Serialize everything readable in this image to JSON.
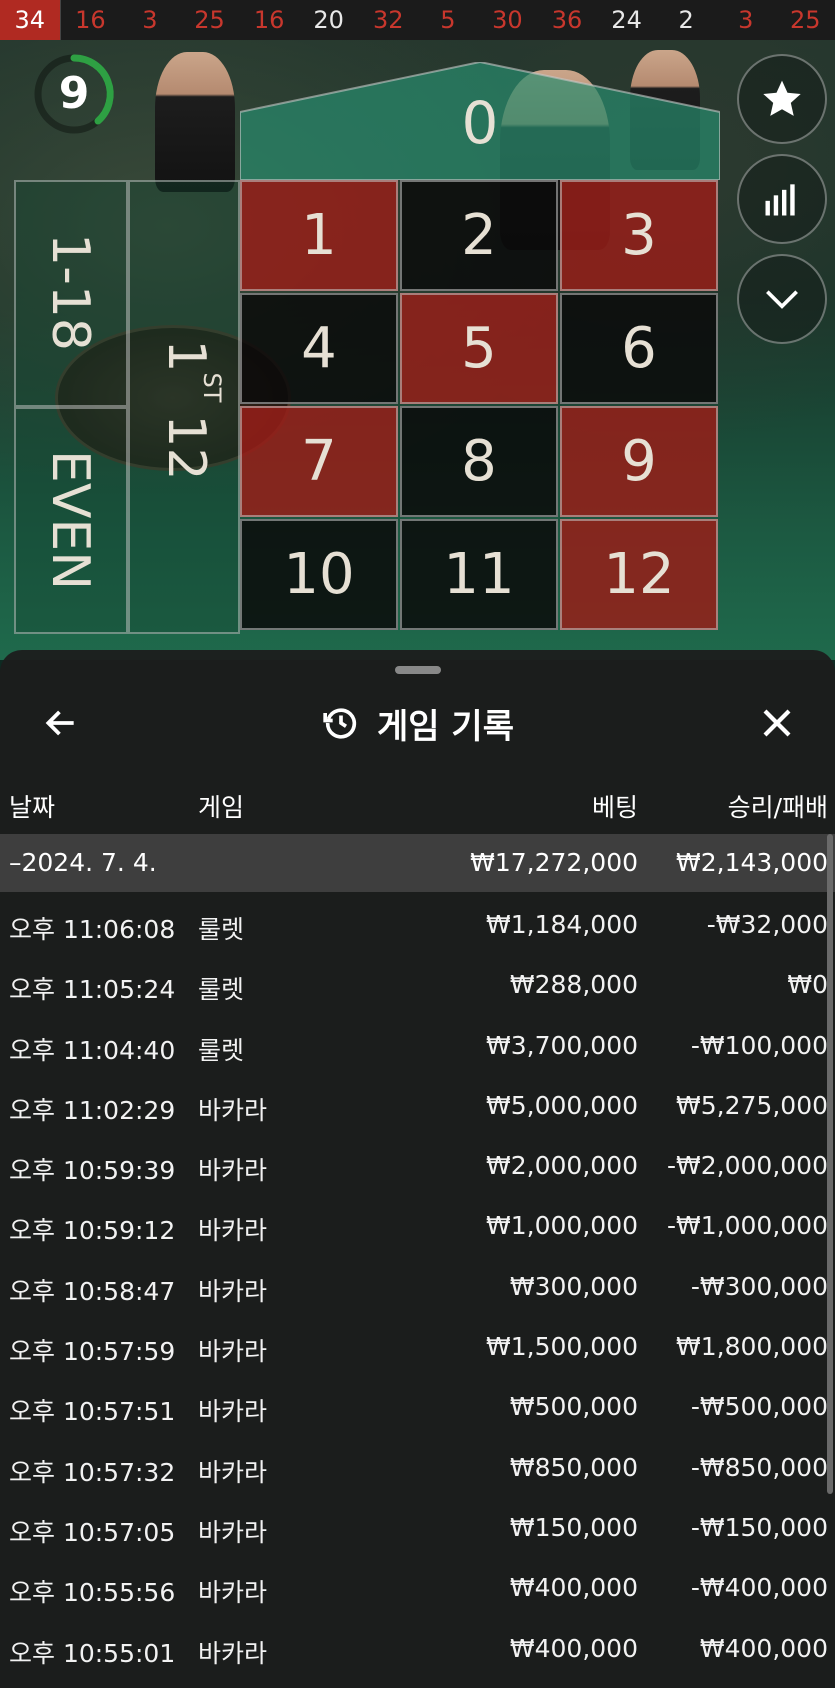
{
  "results_strip": [
    {
      "value": "34",
      "color": "red",
      "latest": true
    },
    {
      "value": "16",
      "color": "red"
    },
    {
      "value": "3",
      "color": "red"
    },
    {
      "value": "25",
      "color": "red"
    },
    {
      "value": "16",
      "color": "red"
    },
    {
      "value": "20",
      "color": "white"
    },
    {
      "value": "32",
      "color": "red"
    },
    {
      "value": "5",
      "color": "red"
    },
    {
      "value": "30",
      "color": "red"
    },
    {
      "value": "36",
      "color": "red"
    },
    {
      "value": "24",
      "color": "white"
    },
    {
      "value": "2",
      "color": "white"
    },
    {
      "value": "3",
      "color": "red"
    },
    {
      "value": "25",
      "color": "red"
    }
  ],
  "timer": {
    "value": "9",
    "color": "#2ea043"
  },
  "side_buttons": {
    "favorite_icon": "star-icon",
    "stats_icon": "bar-chart-icon",
    "collapse_icon": "chevron-down-icon"
  },
  "table": {
    "zero": "0",
    "numbers": [
      {
        "n": "1",
        "color": "red"
      },
      {
        "n": "2",
        "color": "black"
      },
      {
        "n": "3",
        "color": "red"
      },
      {
        "n": "4",
        "color": "black"
      },
      {
        "n": "5",
        "color": "red"
      },
      {
        "n": "6",
        "color": "black"
      },
      {
        "n": "7",
        "color": "red"
      },
      {
        "n": "8",
        "color": "black"
      },
      {
        "n": "9",
        "color": "red"
      },
      {
        "n": "10",
        "color": "black"
      },
      {
        "n": "11",
        "color": "black"
      },
      {
        "n": "12",
        "color": "red"
      }
    ],
    "low_label": "1-18",
    "even_label": "EVEN",
    "dozen_label_num": "1",
    "dozen_label_suffix": "ST",
    "dozen_label_12": "12"
  },
  "history": {
    "title": "게임 기록",
    "history_icon": "history-clock-icon",
    "back_icon": "arrow-left-icon",
    "close_icon": "close-icon",
    "columns": {
      "date": "날짜",
      "game": "게임",
      "bet": "베팅",
      "result": "승리/패배"
    },
    "summary": {
      "date": "–2024. 7. 4.",
      "bet": "₩17,272,000",
      "result": "₩2,143,000"
    },
    "rows": [
      {
        "time": "오후 11:06:08",
        "game": "룰렛",
        "bet": "₩1,184,000",
        "result": "-₩32,000"
      },
      {
        "time": "오후 11:05:24",
        "game": "룰렛",
        "bet": "₩288,000",
        "result": "₩0"
      },
      {
        "time": "오후 11:04:40",
        "game": "룰렛",
        "bet": "₩3,700,000",
        "result": "-₩100,000"
      },
      {
        "time": "오후 11:02:29",
        "game": "바카라",
        "bet": "₩5,000,000",
        "result": "₩5,275,000"
      },
      {
        "time": "오후 10:59:39",
        "game": "바카라",
        "bet": "₩2,000,000",
        "result": "-₩2,000,000"
      },
      {
        "time": "오후 10:59:12",
        "game": "바카라",
        "bet": "₩1,000,000",
        "result": "-₩1,000,000"
      },
      {
        "time": "오후 10:58:47",
        "game": "바카라",
        "bet": "₩300,000",
        "result": "-₩300,000"
      },
      {
        "time": "오후 10:57:59",
        "game": "바카라",
        "bet": "₩1,500,000",
        "result": "₩1,800,000"
      },
      {
        "time": "오후 10:57:51",
        "game": "바카라",
        "bet": "₩500,000",
        "result": "-₩500,000"
      },
      {
        "time": "오후 10:57:32",
        "game": "바카라",
        "bet": "₩850,000",
        "result": "-₩850,000"
      },
      {
        "time": "오후 10:57:05",
        "game": "바카라",
        "bet": "₩150,000",
        "result": "-₩150,000"
      },
      {
        "time": "오후 10:55:56",
        "game": "바카라",
        "bet": "₩400,000",
        "result": "-₩400,000"
      },
      {
        "time": "오후 10:55:01",
        "game": "바카라",
        "bet": "₩400,000",
        "result": "₩400,000"
      }
    ]
  }
}
